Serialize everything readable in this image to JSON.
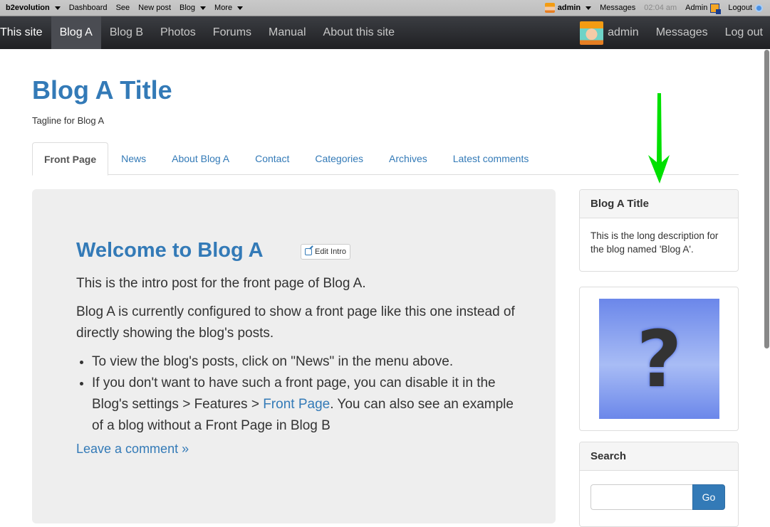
{
  "evobar": {
    "brand": "b2evolution",
    "items": [
      "Dashboard",
      "See",
      "New post",
      "Blog",
      "More"
    ],
    "user": "admin",
    "messages": "Messages",
    "time": "02:04 am",
    "admin": "Admin",
    "logout": "Logout"
  },
  "sitenav": {
    "items": [
      "This site",
      "Blog A",
      "Blog B",
      "Photos",
      "Forums",
      "Manual",
      "About this site"
    ],
    "active": "Blog A",
    "user": "admin",
    "messages": "Messages",
    "logout": "Log out"
  },
  "header": {
    "title": "Blog A Title",
    "tagline": "Tagline for Blog A"
  },
  "tabs": [
    "Front Page",
    "News",
    "About Blog A",
    "Contact",
    "Categories",
    "Archives",
    "Latest comments"
  ],
  "main": {
    "title": "Welcome to Blog A",
    "edit_label": "Edit Intro",
    "p1": "This is the intro post for the front page of Blog A.",
    "p2": "Blog A is currently configured to show a front page like this one instead of directly showing the blog's posts.",
    "bullet1": "To view the blog's posts, click on \"News\" in the menu above.",
    "bullet2_pre": "If you don't want to have such a front page, you can disable it in the Blog's settings > Features > ",
    "bullet2_link": "Front Page",
    "bullet2_post": ". You can also see an example of a blog without a Front Page in Blog B",
    "comment_link": "Leave a comment »"
  },
  "sidebar": {
    "info": {
      "title": "Blog A Title",
      "text": "This is the long description for the blog named 'Blog A'."
    },
    "image": {
      "icon": "question-mark-icon",
      "glyph": "?"
    },
    "search": {
      "title": "Search",
      "value": "",
      "placeholder": "",
      "button": "Go"
    }
  },
  "annotation": {
    "arrow_color": "#00e000"
  },
  "colors": {
    "link": "#337ab7",
    "accent": "#337ab7"
  }
}
